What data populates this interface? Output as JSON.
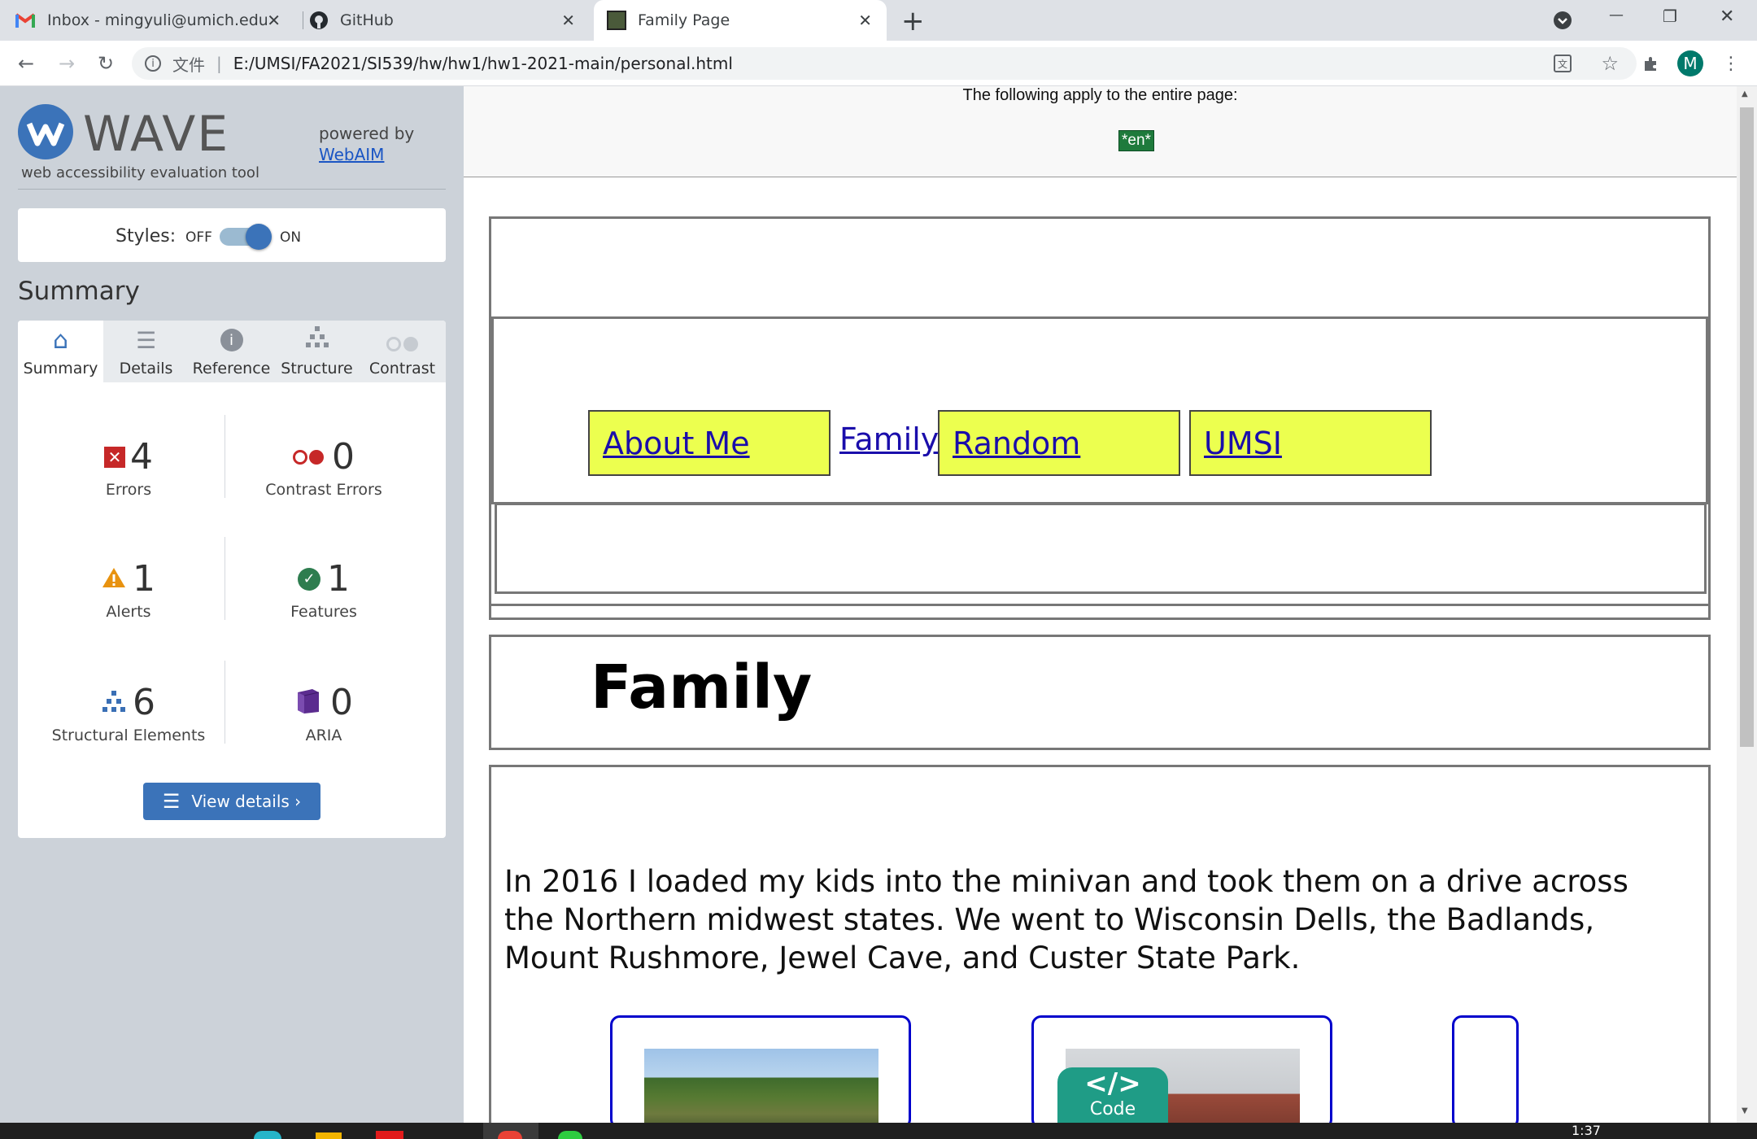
{
  "browser": {
    "tabs": [
      {
        "title": "Inbox - mingyuli@umich.edu -",
        "icon": "gmail-icon"
      },
      {
        "title": "GitHub",
        "icon": "github-icon"
      },
      {
        "title": "Family Page",
        "icon": "page-icon"
      }
    ],
    "close_glyph": "✕",
    "new_tab_glyph": "+",
    "window": {
      "minimize": "—",
      "restore": "❐",
      "close": "✕"
    },
    "address": {
      "file_label": "文件",
      "url": "E:/UMSI/FA2021/SI539/hw/hw1/hw1-2021-main/personal.html"
    },
    "profile_initial": "M",
    "accent_color": "#00796b"
  },
  "wave": {
    "logo_text": "WAVE",
    "tagline": "web accessibility evaluation tool",
    "powered_by": "powered by",
    "webaim_link": "WebAIM",
    "styles_label": "Styles:",
    "off_label": "OFF",
    "on_label": "ON",
    "summary_heading": "Summary",
    "tabs": [
      {
        "label": "Summary",
        "icon": "home-icon"
      },
      {
        "label": "Details",
        "icon": "list-icon"
      },
      {
        "label": "Reference",
        "icon": "info-icon"
      },
      {
        "label": "Structure",
        "icon": "structure-icon"
      },
      {
        "label": "Contrast",
        "icon": "contrast-icon"
      }
    ],
    "stats": {
      "errors": {
        "count": "4",
        "label": "Errors"
      },
      "contrast": {
        "count": "0",
        "label": "Contrast Errors"
      },
      "alerts": {
        "count": "1",
        "label": "Alerts"
      },
      "features": {
        "count": "1",
        "label": "Features"
      },
      "structural": {
        "count": "6",
        "label": "Structural Elements"
      },
      "aria": {
        "count": "0",
        "label": "ARIA"
      }
    },
    "view_details": "View details ›",
    "colors": {
      "error": "#c62828",
      "alert": "#e8920f",
      "feature": "#2e7d4f",
      "structure": "#3a6fb5",
      "aria": "#5b2c8f",
      "button": "#3b73b9"
    }
  },
  "page": {
    "notice": "The following apply to the entire page:",
    "lang_badge": "*en*",
    "nav": [
      "About Me",
      "Family",
      "Random",
      "UMSI"
    ],
    "heading": "Family",
    "paragraph": "In 2016 I loaded my kids into the minivan and took them on a drive across the Northern midwest states. We went to Wisconsin Dells, the Badlands, Mount Rushmore, Jewel Cave, and Custer State Park.",
    "code_badge": "Code",
    "code_glyph": "</>"
  },
  "taskbar": {
    "time": "1:37"
  }
}
